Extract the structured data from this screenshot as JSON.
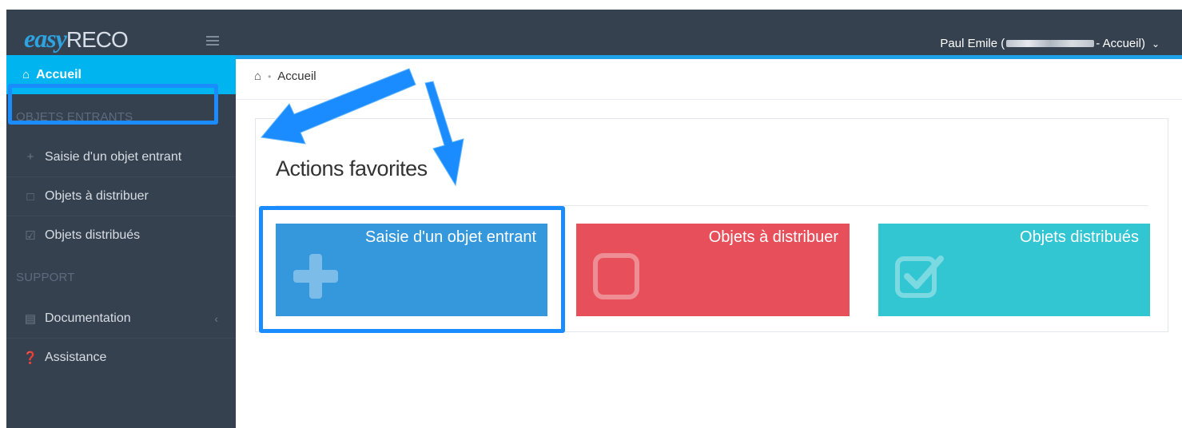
{
  "header": {
    "logo_easy": "easy",
    "logo_reco": "RECO",
    "user_name": "Paul Emile (",
    "user_context": "- Accueil)",
    "chevron_icon": "chevron-down-icon"
  },
  "sidebar": {
    "active_item": {
      "label": "Accueil",
      "icon": "home-icon"
    },
    "section_incoming": "OBJETS ENTRANTS",
    "items": [
      {
        "label": "Saisie d'un objet entrant",
        "icon": "plus-icon"
      },
      {
        "label": "Objets à distribuer",
        "icon": "square-icon"
      },
      {
        "label": "Objets distribués",
        "icon": "check-square-icon"
      }
    ],
    "section_support": "SUPPORT",
    "support_items": [
      {
        "label": "Documentation",
        "icon": "book-icon"
      },
      {
        "label": "Assistance",
        "icon": "question-circle-icon"
      }
    ]
  },
  "breadcrumb": {
    "current": "Accueil"
  },
  "main": {
    "panel_title": "Actions favorites",
    "tiles": [
      {
        "label": "Saisie d'un objet entrant",
        "icon": "plus-icon",
        "color": "#3598dc"
      },
      {
        "label": "Objets à distribuer",
        "icon": "square-icon",
        "color": "#e7505a"
      },
      {
        "label": "Objets distribués",
        "icon": "check-square-icon",
        "color": "#32c5d2"
      }
    ]
  },
  "colors": {
    "topbar": "#364150",
    "sidebar": "#364150",
    "active": "#00b4f0",
    "annotation": "#1a8cff"
  }
}
